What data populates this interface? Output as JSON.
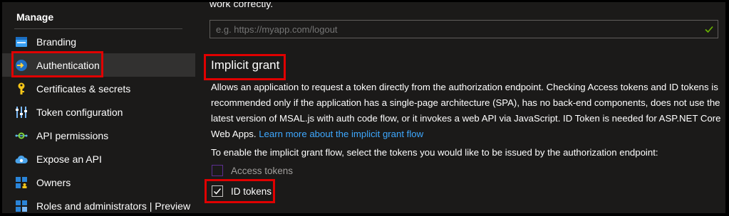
{
  "sidebar": {
    "section_title": "Manage",
    "items": [
      {
        "label": "Branding",
        "icon": "branding-icon"
      },
      {
        "label": "Authentication",
        "icon": "authentication-icon",
        "active": true
      },
      {
        "label": "Certificates & secrets",
        "icon": "key-icon"
      },
      {
        "label": "Token configuration",
        "icon": "token-config-icon"
      },
      {
        "label": "API permissions",
        "icon": "api-permissions-icon"
      },
      {
        "label": "Expose an API",
        "icon": "cloud-icon"
      },
      {
        "label": "Owners",
        "icon": "owners-icon"
      },
      {
        "label": "Roles and administrators | Preview",
        "icon": "roles-icon"
      }
    ]
  },
  "main": {
    "cut_text": "work correctly.",
    "logout_url": {
      "value": "",
      "placeholder": "e.g. https://myapp.com/logout"
    },
    "section_title": "Implicit grant",
    "description": "Allows an application to request a token directly from the authorization endpoint. Checking Access tokens and ID tokens is recommended only if the application has a single-page architecture (SPA), has no back-end components, does not use the latest version of MSAL.js with auth code flow, or it invokes a web API via JavaScript. ID Token is needed for ASP.NET Core Web Apps.",
    "learn_more_link": "Learn more about the implicit grant flow",
    "instruction": "To enable the implicit grant flow, select the tokens you would like to be issued by the authorization endpoint:",
    "tokens": [
      {
        "label": "Access tokens",
        "checked": false
      },
      {
        "label": "ID tokens",
        "checked": true
      }
    ]
  },
  "colors": {
    "background": "#1b1a19",
    "highlight": "#e00000",
    "link": "#3ea8ff",
    "valid_check": "#6bb700"
  }
}
